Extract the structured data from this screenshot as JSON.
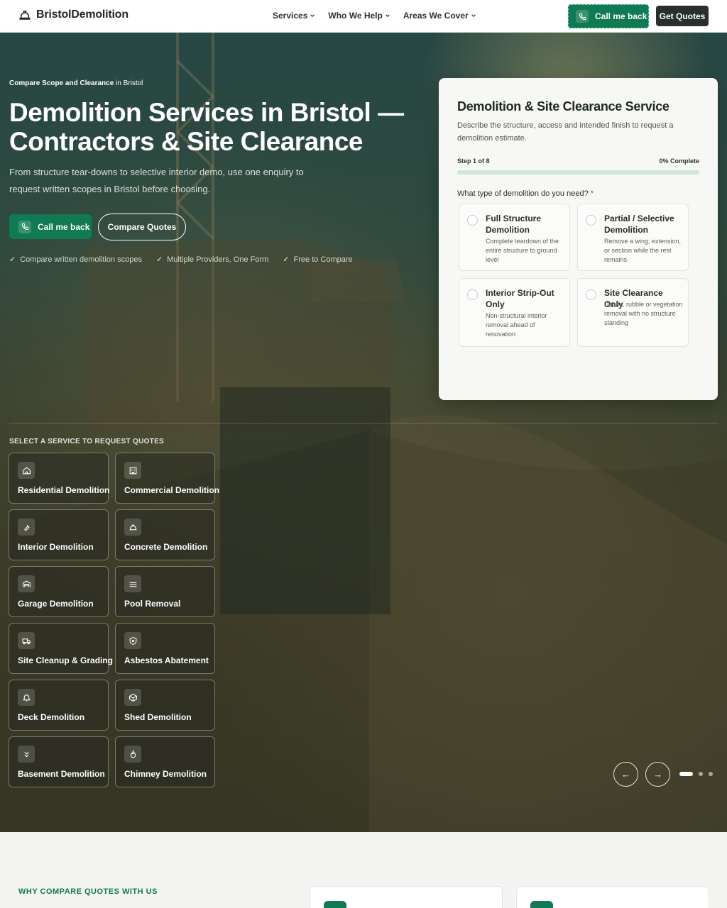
{
  "nav": {
    "logo": "BristolDemolition",
    "menu": [
      {
        "label": "Services"
      },
      {
        "label": "Who We Help"
      },
      {
        "label": "Areas We Cover"
      }
    ],
    "call_label": "Call me back",
    "quotes_label": "Get Quotes"
  },
  "hero": {
    "eyebrow_bold": "Compare Scope and Clearance",
    "eyebrow_rest": " in Bristol",
    "title": "Demolition Services in Bristol — Contractors & Site Clearance",
    "subtitle": "From structure tear-downs to selective interior demo, use one enquiry to request written scopes in Bristol before choosing.",
    "call_label": "Call me back",
    "compare_label": "Compare Quotes",
    "badges": [
      "Compare written demolition scopes",
      "Multiple Providers, One Form",
      "Free to Compare"
    ]
  },
  "form": {
    "title": "Demolition & Site Clearance Service",
    "description": "Describe the structure, access and intended finish to request a demolition estimate.",
    "step": "Step 1 of 8",
    "percent": "0% Complete",
    "progress": 0,
    "question": "What type of demolition do you need?",
    "required_mark": "*",
    "options": [
      {
        "title": "Full Structure Demolition",
        "desc": "Complete teardown of the entire structure to ground level"
      },
      {
        "title": "Partial / Selective Demolition",
        "desc": "Remove a wing, extension, or section while the rest remains"
      },
      {
        "title": "Interior Strip-Out Only",
        "desc": "Non-structural interior removal ahead of renovation"
      },
      {
        "title": "Site Clearance Only",
        "desc": "Debris, rubble or vegetation removal with no structure standing"
      }
    ]
  },
  "services": {
    "heading": "SELECT A SERVICE TO REQUEST QUOTES",
    "items": [
      {
        "label": "Residential Demolition",
        "icon": "house-icon"
      },
      {
        "label": "Commercial Demolition",
        "icon": "building-icon"
      },
      {
        "label": "Interior Demolition",
        "icon": "wrench-icon"
      },
      {
        "label": "Concrete Demolition",
        "icon": "hardhat-icon"
      },
      {
        "label": "Garage Demolition",
        "icon": "garage-icon"
      },
      {
        "label": "Pool Removal",
        "icon": "waves-icon"
      },
      {
        "label": "Site Cleanup & Grading",
        "icon": "truck-icon"
      },
      {
        "label": "Asbestos Abatement",
        "icon": "shield-icon"
      },
      {
        "label": "Deck Demolition",
        "icon": "bell-icon"
      },
      {
        "label": "Shed Demolition",
        "icon": "box-icon"
      },
      {
        "label": "Basement Demolition",
        "icon": "chevrons-down-icon"
      },
      {
        "label": "Chimney Demolition",
        "icon": "flame-icon"
      }
    ]
  },
  "carousel": {
    "prev": "←",
    "next": "→"
  },
  "why": {
    "heading": "WHY COMPARE QUOTES WITH US"
  },
  "colors": {
    "accent": "#0f7a53",
    "dark": "#27302a",
    "card": "#f7f7f5"
  }
}
